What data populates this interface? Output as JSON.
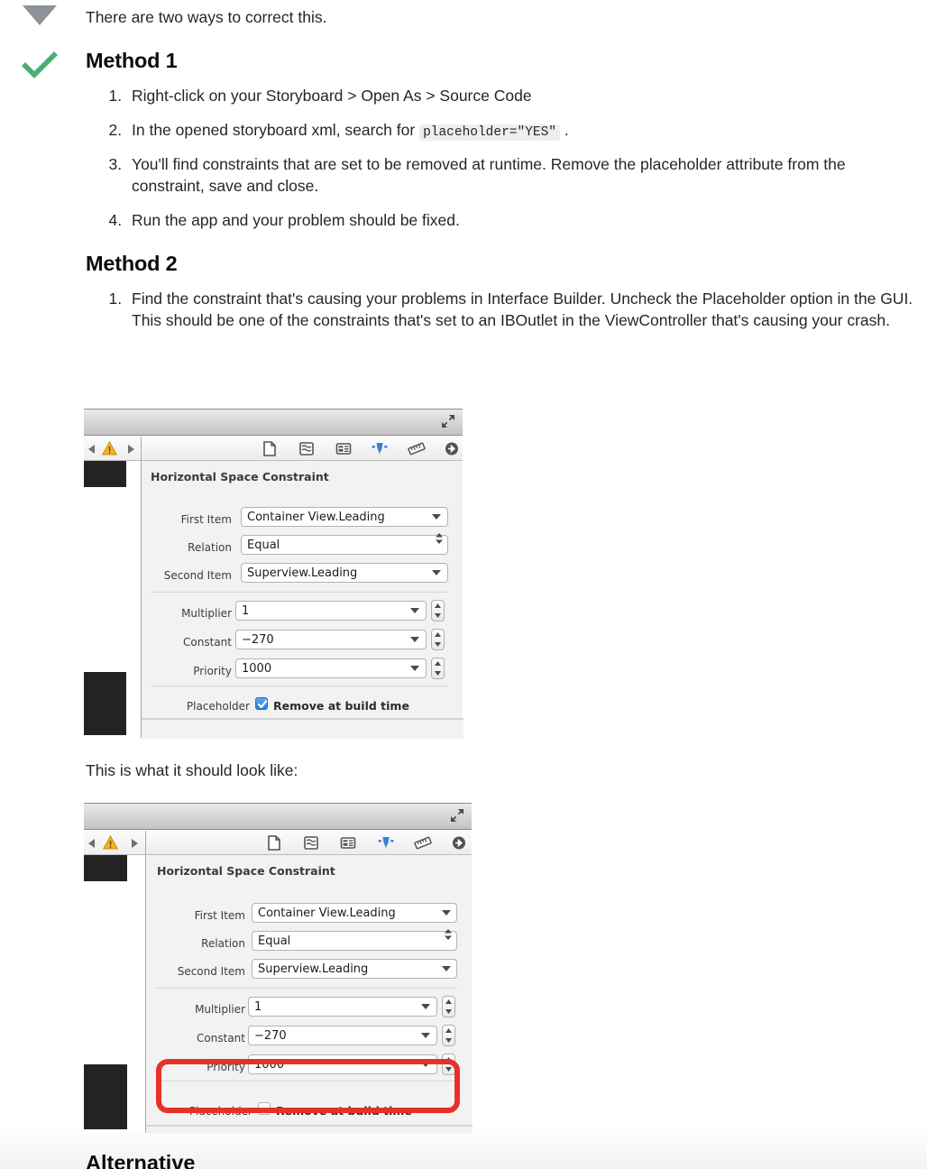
{
  "gutter": {
    "downvote_icon": "downvote-triangle-icon",
    "accepted_icon": "accepted-answer-checkmark-icon"
  },
  "post": {
    "intro": "There are two ways to correct this.",
    "method1": {
      "heading": "Method 1",
      "steps": [
        {
          "text_before": "Right-click on your Storyboard > Open As > Source Code",
          "code": "",
          "text_after": ""
        },
        {
          "text_before": "In the opened storyboard xml, search for ",
          "code": "placeholder=\"YES\"",
          "text_after": " ."
        },
        {
          "text_before": "You'll find constraints that are set to be removed at runtime. Remove the placeholder attribute from the constraint, save and close.",
          "code": "",
          "text_after": ""
        },
        {
          "text_before": "Run the app and your problem should be fixed.",
          "code": "",
          "text_after": ""
        }
      ]
    },
    "method2": {
      "heading": "Method 2",
      "steps": [
        {
          "text_before": "Find the constraint that's causing your problems in Interface Builder. Uncheck the Placeholder option in the GUI. This should be one of the constraints that's set to an IBOutlet in the ViewController that's causing your crash.",
          "code": "",
          "text_after": ""
        }
      ]
    },
    "caption_should_look": "This is what it should look like:",
    "next_heading": "Alternative"
  },
  "inspector": {
    "title": "Horizontal Space Constraint",
    "toolbar_icons": [
      "file-inspector-icon",
      "quick-help-inspector-icon",
      "identity-inspector-icon",
      "attributes-inspector-icon",
      "size-inspector-icon",
      "connections-inspector-icon"
    ],
    "jumpbar": {
      "back_icon": "nav-back-arrow-icon",
      "warning_icon": "warning-triangle-icon",
      "forward_icon": "nav-forward-arrow-icon"
    },
    "expand_icon": "expand-editor-icon",
    "rows": [
      {
        "label": "First Item",
        "value": "Container View.Leading",
        "control": "popup"
      },
      {
        "label": "Relation",
        "value": "Equal",
        "control": "select"
      },
      {
        "label": "Second Item",
        "value": "Superview.Leading",
        "control": "popup"
      },
      {
        "label": "Multiplier",
        "value": "1",
        "control": "combo-stepper"
      },
      {
        "label": "Constant",
        "value": "−270",
        "control": "combo-stepper"
      },
      {
        "label": "Priority",
        "value": "1000",
        "control": "combo-stepper"
      }
    ],
    "placeholder_row": {
      "label": "Placeholder",
      "checkbox_label": "Remove at build time",
      "checked_before": true,
      "checked_after": false
    }
  },
  "colors": {
    "accept_green": "#4caf72",
    "downvote_gray": "#8c9298",
    "highlight_red": "#e8302a",
    "inspector_blue": "#3b7fd4",
    "warning_yellow": "#f5b324",
    "code_bg": "#eceef0"
  }
}
